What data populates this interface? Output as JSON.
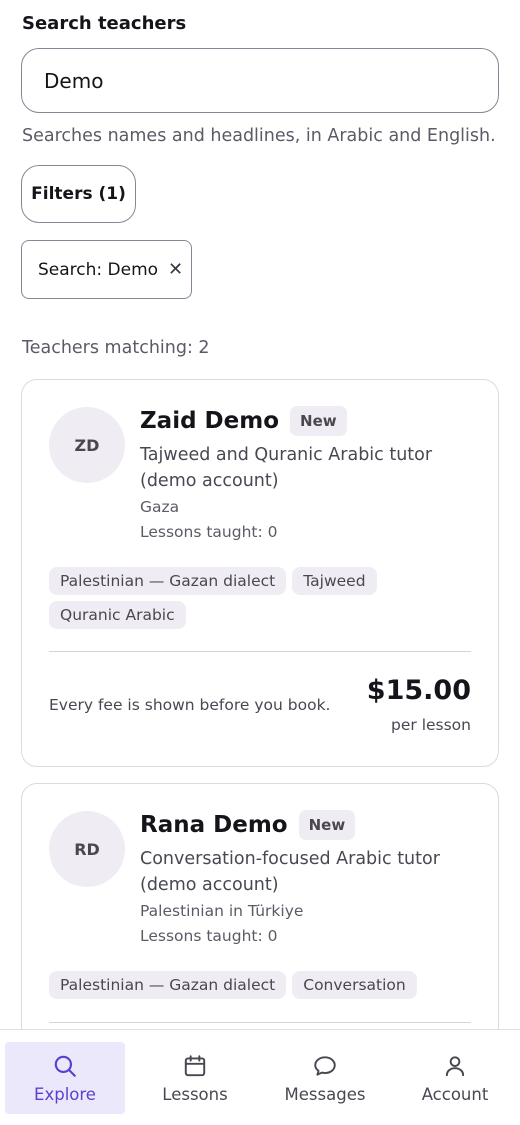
{
  "search": {
    "label": "Search teachers",
    "value": "Demo",
    "helper": "Searches names and headlines, in Arabic and English."
  },
  "filters": {
    "button_label": "Filters (1)"
  },
  "active_chip": {
    "label": "Search: Demo",
    "remove_icon": "close-icon"
  },
  "results": {
    "summary": "Teachers matching: 2",
    "teachers": [
      {
        "initials": "ZD",
        "name": "Zaid Demo",
        "badge": "New",
        "headline": "Tajweed and Quranic Arabic tutor (demo account)",
        "location": "Gaza",
        "lessons": "Lessons taught: 0",
        "tags": [
          "Palestinian — Gazan dialect",
          "Tajweed",
          "Quranic Arabic"
        ],
        "fee_note": "Every fee is shown before you book.",
        "price": "$15.00",
        "price_unit": "per lesson"
      },
      {
        "initials": "RD",
        "name": "Rana Demo",
        "badge": "New",
        "headline": "Conversation-focused Arabic tutor (demo account)",
        "location": "Palestinian in Türkiye",
        "lessons": "Lessons taught: 0",
        "tags": [
          "Palestinian — Gazan dialect",
          "Conversation"
        ]
      }
    ]
  },
  "nav": {
    "items": [
      {
        "label": "Explore",
        "icon": "search-icon",
        "active": true
      },
      {
        "label": "Lessons",
        "icon": "calendar-icon",
        "active": false
      },
      {
        "label": "Messages",
        "icon": "chat-bubble-icon",
        "active": false
      },
      {
        "label": "Account",
        "icon": "person-icon",
        "active": false
      }
    ]
  },
  "colors": {
    "accent": "#5b3fd0",
    "accent_bg": "#ece8fb",
    "chip_bg": "#efedf3"
  }
}
